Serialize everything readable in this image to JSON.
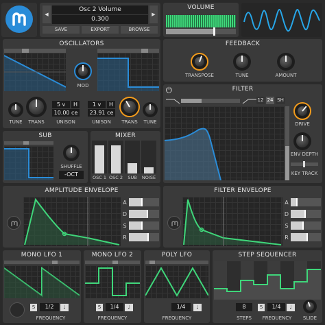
{
  "preset": {
    "name": "Osc 2 Volume",
    "value": "0.300",
    "prev_icon": "chevron-left-icon",
    "next_icon": "chevron-right-icon",
    "save": "SAVE",
    "export": "EXPORT",
    "browse": "BROWSE"
  },
  "volume": {
    "title": "VOLUME"
  },
  "oscillators": {
    "title": "OSCILLATORS",
    "mod_label": "MOD",
    "tune1": "TUNE",
    "trans1": "TRANS",
    "unison1_voices": "5 v",
    "unison1_mode": "H",
    "unison1_detune": "10.00 ce",
    "unison1_label": "UNISON",
    "unison2_voices": "1 v",
    "unison2_mode": "H",
    "unison2_detune": "23.91 ce",
    "unison2_label": "UNISON",
    "trans2": "TRANS",
    "tune2": "TUNE"
  },
  "feedback": {
    "title": "FEEDBACK",
    "transpose": "TRANSPOSE",
    "tune": "TUNE",
    "amount": "AMOUNT"
  },
  "filter": {
    "title": "FILTER",
    "slope12": "12",
    "slope24": "24",
    "shelf": "SH",
    "drive": "DRIVE",
    "env_depth": "ENV DEPTH",
    "key_track": "KEY TRACK"
  },
  "sub": {
    "title": "SUB",
    "shuffle": "SHUFFLE",
    "octave": "-OCT"
  },
  "mixer": {
    "title": "MIXER",
    "channels": [
      {
        "label": "OSC 1",
        "level": 0.85
      },
      {
        "label": "OSC 2",
        "level": 0.85
      },
      {
        "label": "SUB",
        "level": 0.32
      },
      {
        "label": "NOISE",
        "level": 0.18
      }
    ]
  },
  "amp_env": {
    "title": "AMPLITUDE ENVELOPE",
    "labels": [
      "A",
      "D",
      "S",
      "R"
    ]
  },
  "filter_env": {
    "title": "FILTER ENVELOPE",
    "labels": [
      "A",
      "D",
      "S",
      "R"
    ]
  },
  "mono_lfo1": {
    "title": "MONO LFO 1",
    "sync": "S",
    "rate": "1/2",
    "frequency": "FREQUENCY"
  },
  "mono_lfo2": {
    "title": "MONO LFO 2",
    "sync": "S",
    "rate": "1/4",
    "frequency": "FREQUENCY"
  },
  "poly_lfo": {
    "title": "POLY LFO",
    "rate": "1/4",
    "frequency": "FREQUENCY"
  },
  "step_seq": {
    "title": "STEP SEQUENCER",
    "steps_value": "8",
    "steps": "STEPS",
    "sync": "S",
    "rate": "1/4",
    "frequency": "FREQUENCY",
    "slide": "SLIDE"
  },
  "colors": {
    "accent": "#f29b1c",
    "blue": "#2a8cd8",
    "green": "#3fd67a",
    "cyan": "#27a6e8"
  }
}
